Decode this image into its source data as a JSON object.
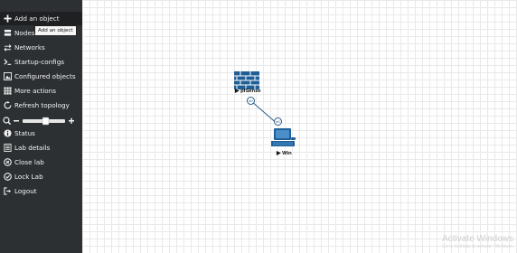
{
  "sidebar": {
    "items": [
      {
        "label": "Add an object",
        "icon": "plus-icon",
        "active": true
      },
      {
        "label": "Nodes",
        "icon": "server-icon"
      },
      {
        "label": "Networks",
        "icon": "exchange-icon"
      },
      {
        "label": "Startup-configs",
        "icon": "terminal-icon"
      },
      {
        "label": "Configured objects",
        "icon": "image-icon"
      },
      {
        "label": "More actions",
        "icon": "grid-icon"
      },
      {
        "label": "Refresh topology",
        "icon": "refresh-icon"
      },
      {
        "label": "Status",
        "icon": "info-icon"
      },
      {
        "label": "Lab details",
        "icon": "list-icon"
      },
      {
        "label": "Close lab",
        "icon": "close-circle-icon"
      },
      {
        "label": "Lock Lab",
        "icon": "check-circle-icon"
      },
      {
        "label": "Logout",
        "icon": "logout-icon"
      }
    ],
    "tooltip": "Add an object",
    "zoom": {
      "level": 0.55
    }
  },
  "topology": {
    "nodes": [
      {
        "name": "pfSense",
        "icon": "firewall-icon"
      },
      {
        "name": "Win",
        "icon": "computer-icon"
      }
    ],
    "link": {
      "from": "pfSense",
      "to": "Win",
      "from_port": "e0",
      "to_port": "e0"
    }
  },
  "watermark": {
    "title": "Activate Windows",
    "subtitle": "Go to Settings to activate Windows."
  },
  "colors": {
    "sidebar_bg": "#2d3033",
    "link": "#2a5b8c"
  }
}
